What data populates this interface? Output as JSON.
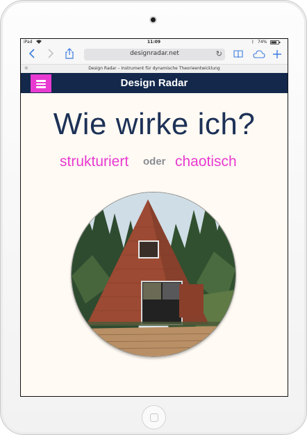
{
  "status_bar": {
    "device": "iPad",
    "time": "11:09",
    "battery": "74%"
  },
  "browser": {
    "url": "designradar.net",
    "tab_title": "Design Radar – Instrument für dynamische Theorieentwicklung",
    "icons": [
      "back-icon",
      "forward-icon",
      "share-icon",
      "reload-icon",
      "bookmarks-icon",
      "cloud-tabs-icon",
      "new-tab-icon"
    ]
  },
  "site": {
    "title": "Design Radar",
    "headline": "Wie wirke ich?",
    "option_left": "strukturiert",
    "separator": "oder",
    "option_right": "chaotisch"
  },
  "colors": {
    "header": "#13284b",
    "accent": "#e83ad1",
    "headline": "#1d3157",
    "background": "#fffaf3"
  }
}
